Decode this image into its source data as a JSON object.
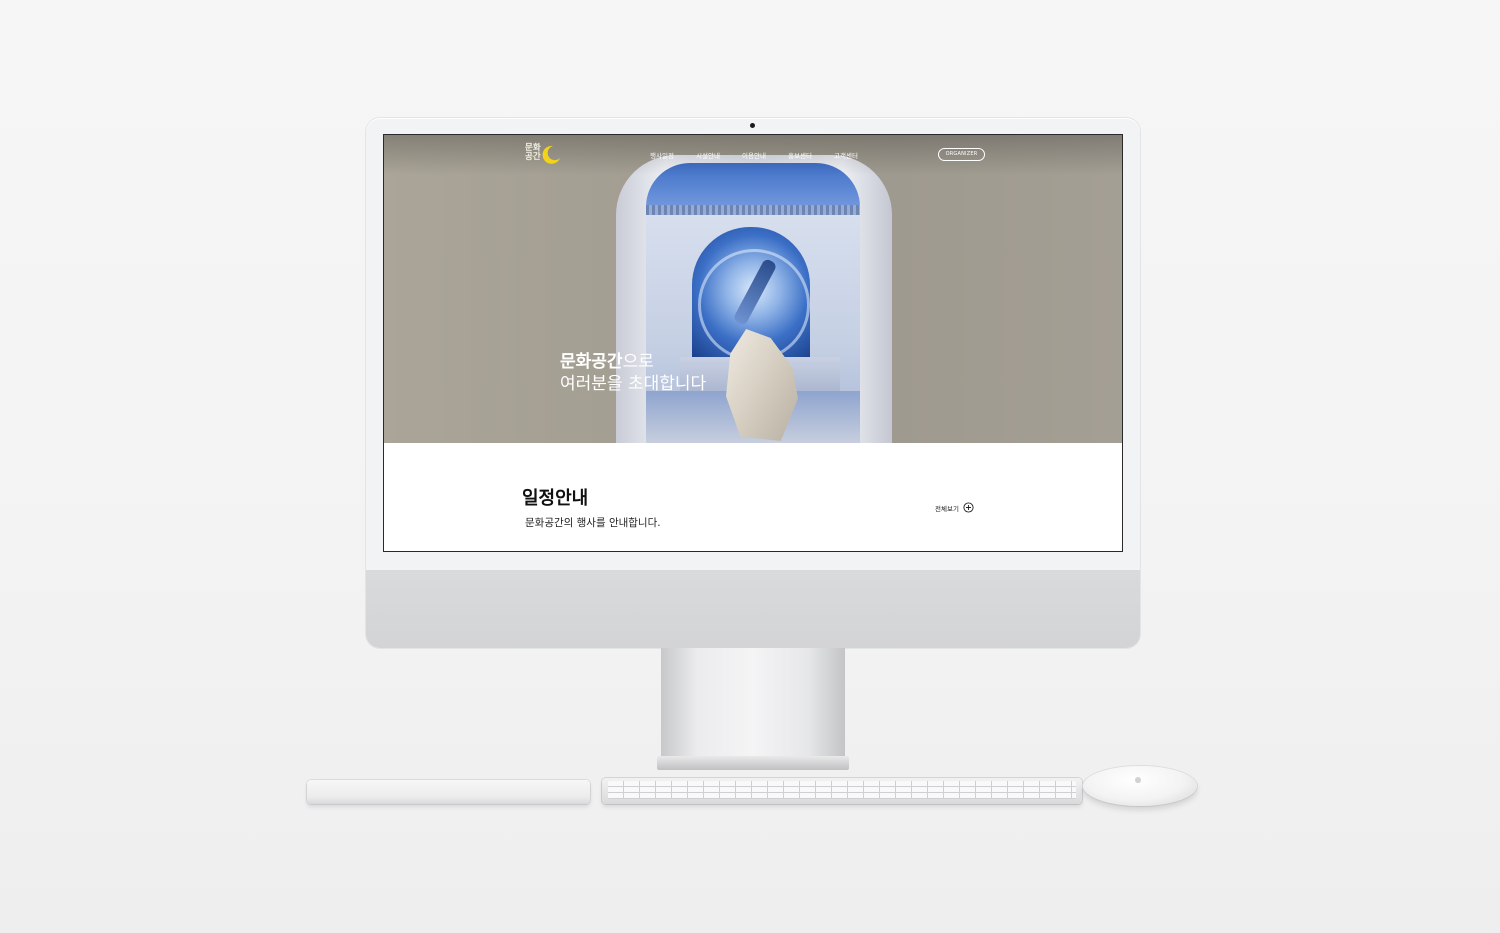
{
  "site": {
    "logo_text": "문화\n공간",
    "nav": [
      {
        "label": "행사일정"
      },
      {
        "label": "시설안내"
      },
      {
        "label": "이용안내"
      },
      {
        "label": "홍보센터"
      },
      {
        "label": "고객센터"
      }
    ],
    "organizer_label": "ORGANIZER"
  },
  "hero": {
    "title_emphasis": "문화공간",
    "title_rest_line1": "으로",
    "title_line2": "여러분을 초대합니다"
  },
  "schedule": {
    "title": "일정안내",
    "description": "문화공간의 행사를 안내합니다.",
    "view_all_label": "전체보기"
  },
  "icons": {
    "logo": "crescent-moon-icon",
    "view_all": "plus-circle-icon"
  },
  "colors": {
    "accent_yellow": "#f2d21b",
    "hero_bg": "#a29d91",
    "arch_blue": "#3f6fc6"
  }
}
